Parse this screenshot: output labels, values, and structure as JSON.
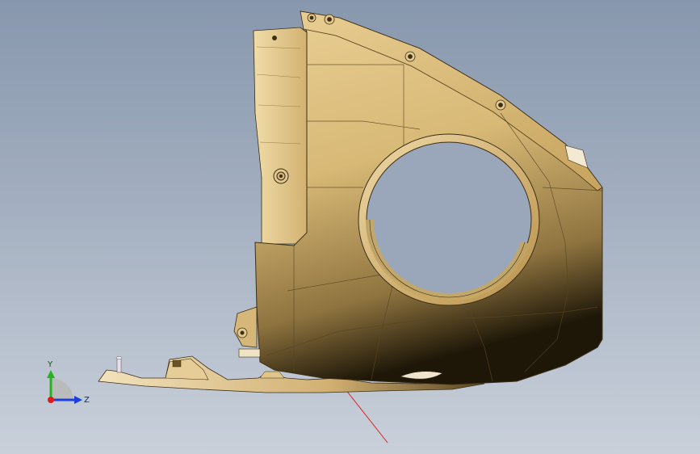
{
  "viewport": {
    "background_top": "#8797ad",
    "background_bottom": "#c9d0da",
    "part_color": "#d8b976",
    "part_shadow": "#1e1708",
    "edge_color": "#3b2f16",
    "triad": {
      "x_label": "",
      "y_label": "Y",
      "z_label": "Z",
      "x_color": "#e01a1a",
      "y_color": "#27b21f",
      "z_color": "#1a3ee0"
    },
    "section_line_color": "#e02020"
  }
}
